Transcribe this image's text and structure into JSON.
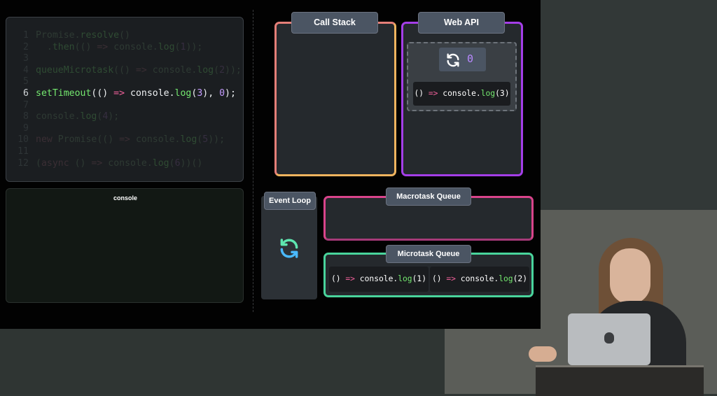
{
  "code": {
    "lines": [
      {
        "num": "1",
        "parts": [
          {
            "t": "Promise.",
            "c": ""
          },
          {
            "t": "resolve",
            "c": "fn"
          },
          {
            "t": "()",
            "c": ""
          }
        ]
      },
      {
        "num": "2",
        "parts": [
          {
            "t": "  .",
            "c": ""
          },
          {
            "t": "then",
            "c": "fn"
          },
          {
            "t": "(() ",
            "c": ""
          },
          {
            "t": "=>",
            "c": "kw"
          },
          {
            "t": " console.",
            "c": ""
          },
          {
            "t": "log",
            "c": "fn"
          },
          {
            "t": "(",
            "c": ""
          },
          {
            "t": "1",
            "c": "num"
          },
          {
            "t": "));",
            "c": ""
          }
        ]
      },
      {
        "num": "3",
        "parts": []
      },
      {
        "num": "4",
        "parts": [
          {
            "t": "queueMicrotask",
            "c": "fn"
          },
          {
            "t": "(() ",
            "c": ""
          },
          {
            "t": "=>",
            "c": "kw"
          },
          {
            "t": " console.",
            "c": ""
          },
          {
            "t": "log",
            "c": "fn"
          },
          {
            "t": "(",
            "c": ""
          },
          {
            "t": "2",
            "c": "num"
          },
          {
            "t": "));",
            "c": ""
          }
        ]
      },
      {
        "num": "5",
        "parts": []
      },
      {
        "num": "6",
        "active": true,
        "parts": [
          {
            "t": "setTimeout",
            "c": "fn"
          },
          {
            "t": "(() ",
            "c": ""
          },
          {
            "t": "=>",
            "c": "kw"
          },
          {
            "t": " console.",
            "c": ""
          },
          {
            "t": "log",
            "c": "fn"
          },
          {
            "t": "(",
            "c": ""
          },
          {
            "t": "3",
            "c": "num"
          },
          {
            "t": "), ",
            "c": ""
          },
          {
            "t": "0",
            "c": "num"
          },
          {
            "t": ");",
            "c": ""
          }
        ]
      },
      {
        "num": "7",
        "parts": []
      },
      {
        "num": "8",
        "parts": [
          {
            "t": "console.",
            "c": ""
          },
          {
            "t": "log",
            "c": "fn"
          },
          {
            "t": "(",
            "c": ""
          },
          {
            "t": "4",
            "c": "num"
          },
          {
            "t": ");",
            "c": ""
          }
        ]
      },
      {
        "num": "9",
        "parts": []
      },
      {
        "num": "10",
        "parts": [
          {
            "t": "new",
            "c": "kw"
          },
          {
            "t": " Promise(() ",
            "c": ""
          },
          {
            "t": "=>",
            "c": "kw"
          },
          {
            "t": " console.",
            "c": ""
          },
          {
            "t": "log",
            "c": "fn"
          },
          {
            "t": "(",
            "c": ""
          },
          {
            "t": "5",
            "c": "num"
          },
          {
            "t": "));",
            "c": ""
          }
        ]
      },
      {
        "num": "11",
        "parts": []
      },
      {
        "num": "12",
        "parts": [
          {
            "t": "(",
            "c": ""
          },
          {
            "t": "async",
            "c": "kw"
          },
          {
            "t": " () ",
            "c": ""
          },
          {
            "t": "=>",
            "c": "kw"
          },
          {
            "t": " console.",
            "c": ""
          },
          {
            "t": "log",
            "c": "fn"
          },
          {
            "t": "(",
            "c": ""
          },
          {
            "t": "6",
            "c": "num"
          },
          {
            "t": "))()",
            "c": ""
          }
        ]
      }
    ]
  },
  "console": {
    "title": "console"
  },
  "panels": {
    "call_stack": "Call Stack",
    "web_api": "Web API",
    "event_loop": "Event Loop",
    "macrotask_queue": "Macrotask Queue",
    "microtask_queue": "Microtask Queue"
  },
  "web_api": {
    "timer_value": "0",
    "callback": [
      {
        "t": "() ",
        "c": ""
      },
      {
        "t": "=>",
        "c": "pink"
      },
      {
        "t": " console.",
        "c": ""
      },
      {
        "t": "log",
        "c": "green"
      },
      {
        "t": "(3)",
        "c": ""
      }
    ]
  },
  "microtasks": [
    [
      {
        "t": "() ",
        "c": ""
      },
      {
        "t": "=>",
        "c": "pink"
      },
      {
        "t": " console.",
        "c": ""
      },
      {
        "t": "log",
        "c": "green"
      },
      {
        "t": "(1)",
        "c": ""
      }
    ],
    [
      {
        "t": "() ",
        "c": ""
      },
      {
        "t": "=>",
        "c": "pink"
      },
      {
        "t": " console.",
        "c": ""
      },
      {
        "t": "log",
        "c": "green"
      },
      {
        "t": "(2)",
        "c": ""
      }
    ]
  ],
  "icons": {
    "timer": "refresh-icon",
    "event_loop": "loop-arrows-icon"
  },
  "colors": {
    "call_stack": "#f0b45e",
    "web_api": "#a43ee8",
    "macro": "#d9448b",
    "micro": "#49d49c",
    "label_bg": "#4b5563"
  }
}
